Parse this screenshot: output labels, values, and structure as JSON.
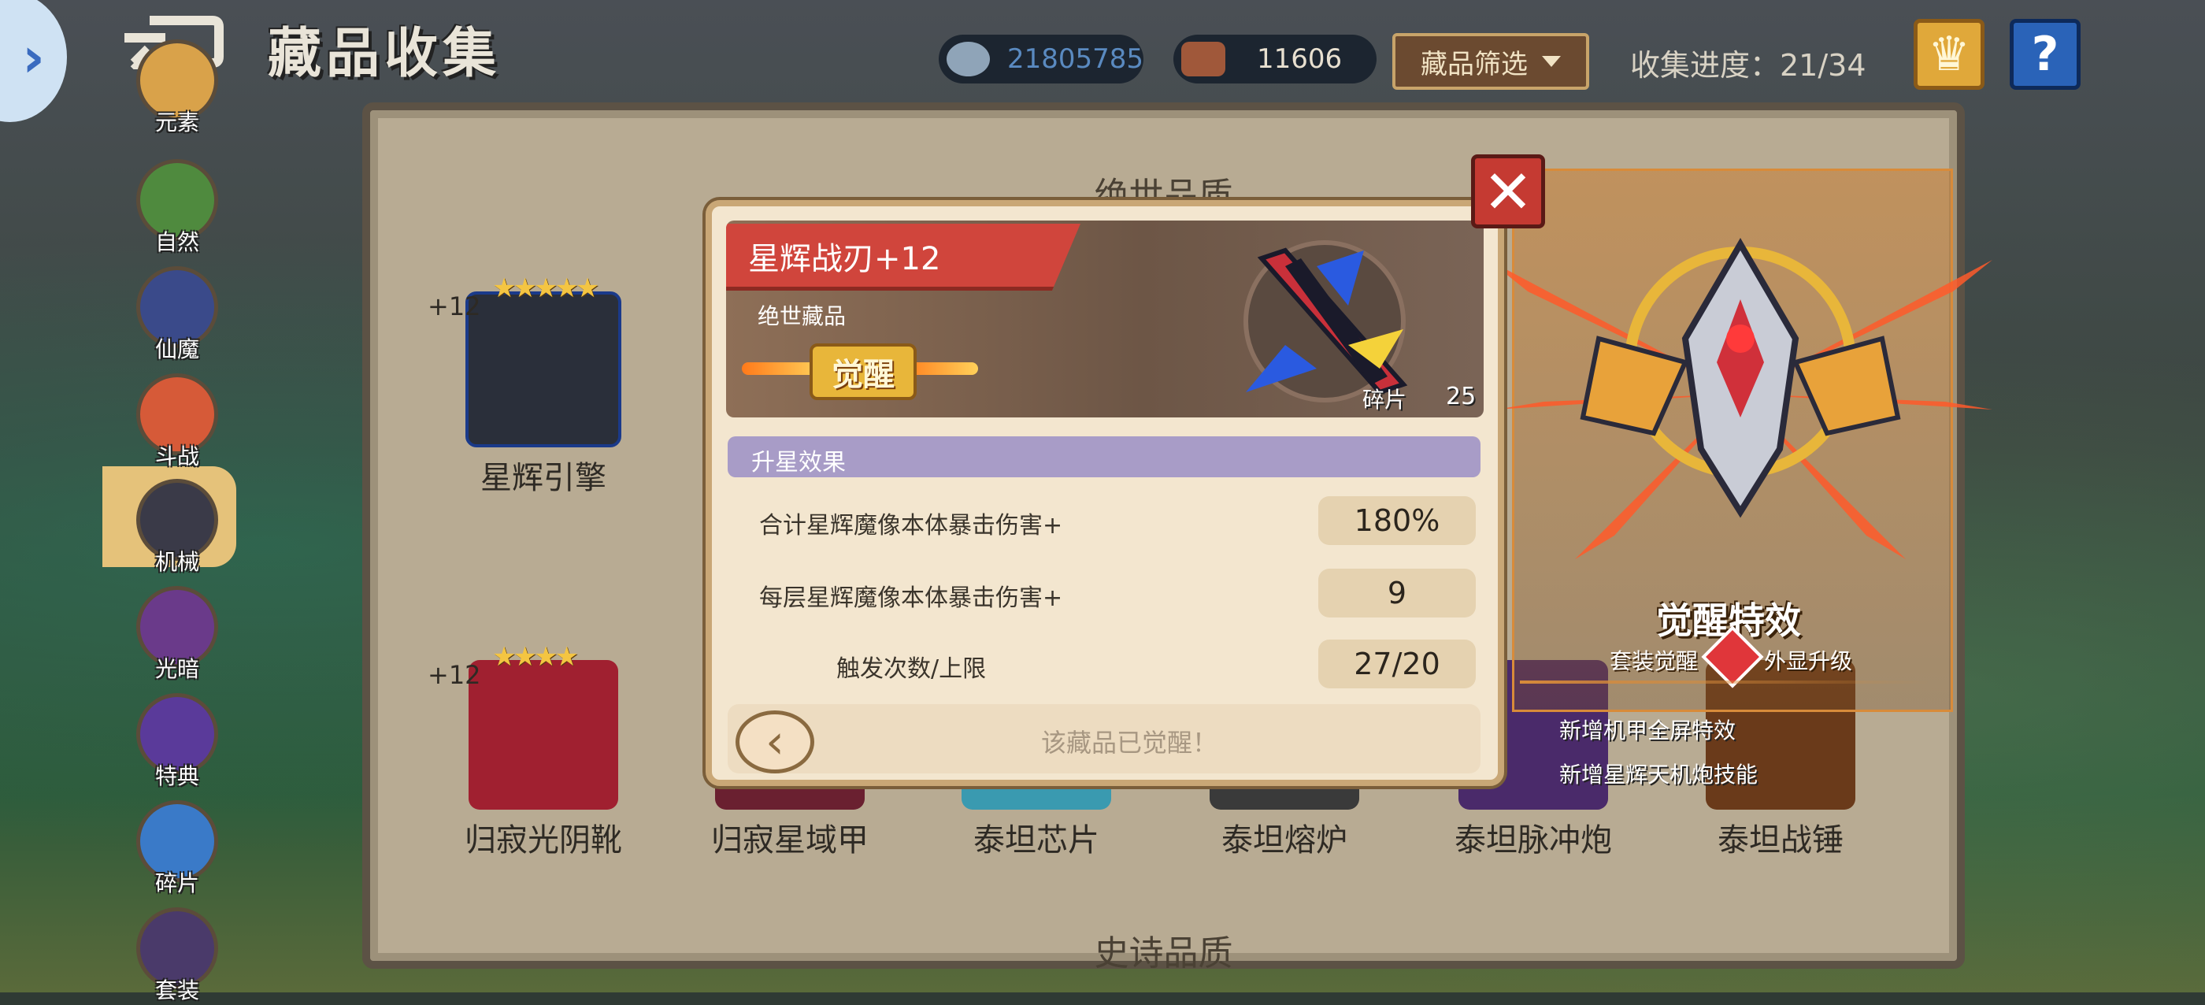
{
  "header": {
    "title": "藏品收集",
    "coins": "21805785",
    "gems": "11606",
    "filter_label": "藏品筛选",
    "progress_label": "收集进度：21/34",
    "help_label": "?"
  },
  "categories": [
    {
      "label": "元素",
      "color": "#d9a24a"
    },
    {
      "label": "自然",
      "color": "#4f8a3e"
    },
    {
      "label": "仙魔",
      "color": "#3a4a8a"
    },
    {
      "label": "斗战",
      "color": "#d65a38"
    },
    {
      "label": "机械",
      "color": "#3a3a48"
    },
    {
      "label": "光暗",
      "color": "#6a3a8a"
    },
    {
      "label": "特典",
      "color": "#5a3a9a"
    },
    {
      "label": "碎片",
      "color": "#3a7ac8"
    },
    {
      "label": "套装",
      "color": "#4a3a6a"
    }
  ],
  "sections": {
    "top": "绝世品质",
    "bottom": "史诗品质"
  },
  "items": [
    {
      "name": "星辉引擎",
      "plus": "+12",
      "stars": "★★★★★",
      "color": "#2a2f3a"
    },
    {
      "name": "归寂光阴靴",
      "plus": "+12",
      "stars": "★★★★",
      "color": "#a02030"
    },
    {
      "name": "归寂星域甲",
      "plus": "",
      "stars": "",
      "color": "#6a2030"
    },
    {
      "name": "泰坦芯片",
      "plus": "",
      "stars": "",
      "color": "#3a9ab0"
    },
    {
      "name": "泰坦熔炉",
      "plus": "",
      "stars": "",
      "color": "#3a3a3a"
    },
    {
      "name": "泰坦脉冲炮",
      "plus": "",
      "stars": "",
      "color": "#4a2a6a"
    },
    {
      "name": "泰坦战锤",
      "plus": "",
      "stars": "",
      "color": "#6a3a1a"
    }
  ],
  "detail": {
    "name": "星辉战刃+12",
    "quality": "绝世藏品",
    "awaken_label": "觉醒",
    "fragments_label": "碎片",
    "fragments": "25",
    "effect_header": "升星效果",
    "rows": [
      {
        "label": "合计星辉魔像本体暴击伤害+",
        "value": "180%"
      },
      {
        "label": "每层星辉魔像本体暴击伤害+",
        "value": "9"
      },
      {
        "label": "触发次数/上限",
        "value": "27/20"
      }
    ],
    "status": "该藏品已觉醒！"
  },
  "awaken_fx": {
    "title": "觉醒特效",
    "left_tag": "套装觉醒",
    "right_tag": "外显升级",
    "notes": [
      "新增机甲全屏特效",
      "新增星辉天机炮技能"
    ]
  }
}
